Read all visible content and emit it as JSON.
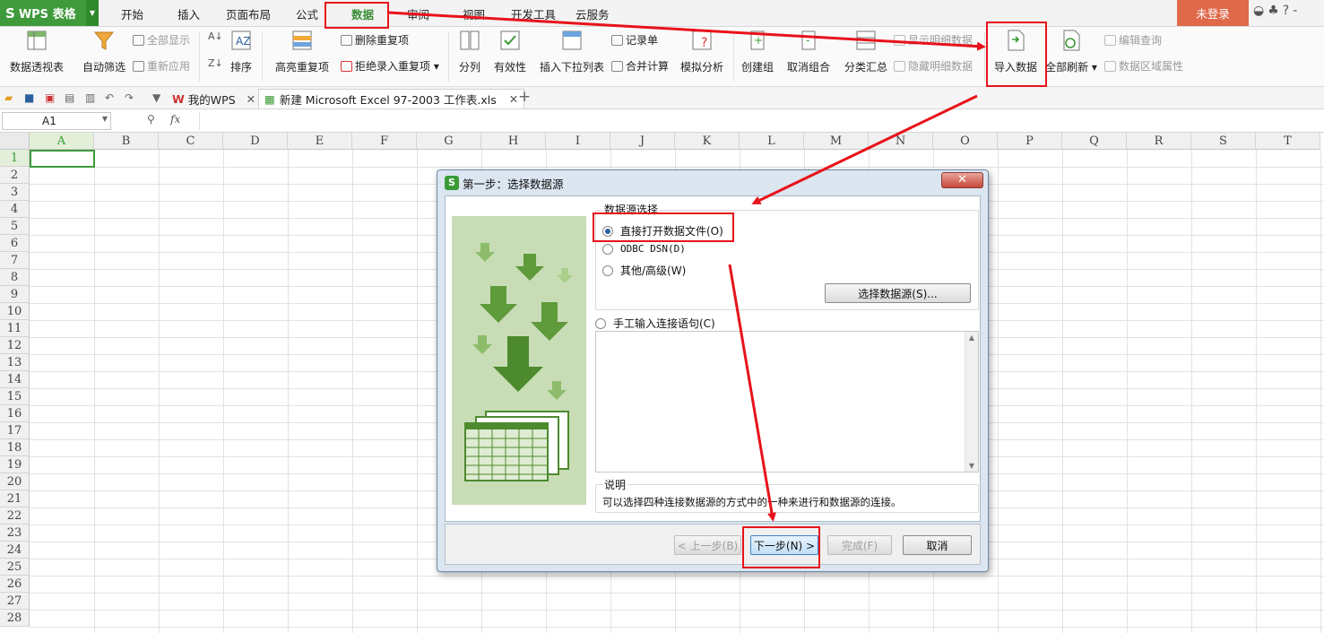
{
  "app": {
    "name": "WPS 表格",
    "login": "未登录"
  },
  "menu": {
    "tabs": [
      "开始",
      "插入",
      "页面布局",
      "公式",
      "数据",
      "审阅",
      "视图",
      "开发工具",
      "云服务"
    ],
    "active": "数据"
  },
  "ribbon": {
    "pivot": "数据透视表",
    "autofilter": "自动筛选",
    "show_all": "全部显示",
    "reapply": "重新应用",
    "sort": "排序",
    "highlight_dup": "高亮重复项",
    "delete_dup": "删除重复项",
    "reject_dup": "拒绝录入重复项",
    "split": "分列",
    "validity": "有效性",
    "dropdown": "插入下拉列表",
    "record": "记录单",
    "consolidate": "合并计算",
    "simulate": "模拟分析",
    "group": "创建组",
    "ungroup": "取消组合",
    "subtotal": "分类汇总",
    "show_detail": "显示明细数据",
    "hide_detail": "隐藏明细数据",
    "import": "导入数据",
    "refresh_all": "全部刷新",
    "edit_query": "编辑查询",
    "range_props": "数据区域属性"
  },
  "tabs": {
    "my_wps": "我的WPS",
    "file": "新建 Microsoft Excel 97-2003 工作表.xls"
  },
  "formula": {
    "cell": "A1",
    "fx": "fx"
  },
  "grid": {
    "columns": [
      "A",
      "B",
      "C",
      "D",
      "E",
      "F",
      "G",
      "H",
      "I",
      "J",
      "K",
      "L",
      "M",
      "N",
      "O",
      "P",
      "Q",
      "R",
      "S",
      "T"
    ],
    "rows": [
      "1",
      "2",
      "3",
      "4",
      "5",
      "6",
      "7",
      "8",
      "9",
      "10",
      "11",
      "12",
      "13",
      "14",
      "15",
      "16",
      "17",
      "18",
      "19",
      "20",
      "21",
      "22",
      "23",
      "24",
      "25",
      "26",
      "27",
      "28"
    ]
  },
  "dialog": {
    "title": "第一步：选择数据源",
    "close": "✕",
    "group_label": "数据源选择",
    "opt_direct": "直接打开数据文件(O)",
    "opt_odbc": "ODBC DSN(D)",
    "opt_other": "其他/高级(W)",
    "choose_source": "选择数据源(S)...",
    "opt_manual": "手工输入连接语句(C)",
    "desc_label": "说明",
    "desc_text": "可以选择四种连接数据源的方式中的一种来进行和数据源的连接。",
    "prev": "< 上一步(B)",
    "next": "下一步(N) >",
    "finish": "完成(F)",
    "cancel": "取消"
  },
  "colors": {
    "accent": "#3b9b3a",
    "annotation": "#e8121a",
    "dialog_bg": "#dbe6f1"
  }
}
